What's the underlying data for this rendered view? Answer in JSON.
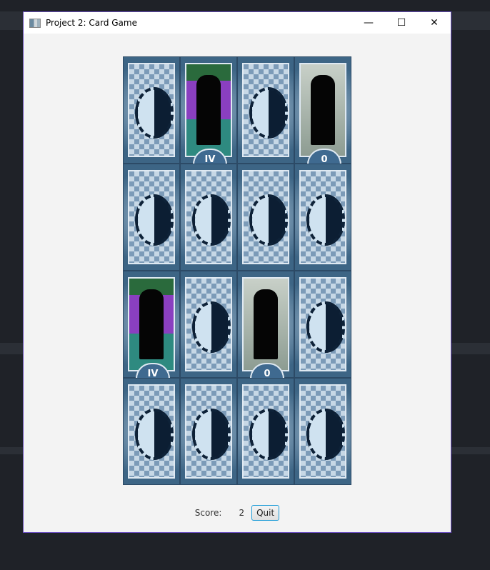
{
  "window": {
    "title": "Project 2: Card Game",
    "minimize": "—",
    "maximize": "☐",
    "close": "✕"
  },
  "cards": [
    [
      "back",
      "IV",
      "back",
      "0"
    ],
    [
      "back",
      "back",
      "back",
      "back"
    ],
    [
      "IV",
      "back",
      "0",
      "back"
    ],
    [
      "back",
      "back",
      "back",
      "back"
    ]
  ],
  "footer": {
    "score_label": "Score:",
    "score_value": "2",
    "quit_label": "Quit"
  }
}
